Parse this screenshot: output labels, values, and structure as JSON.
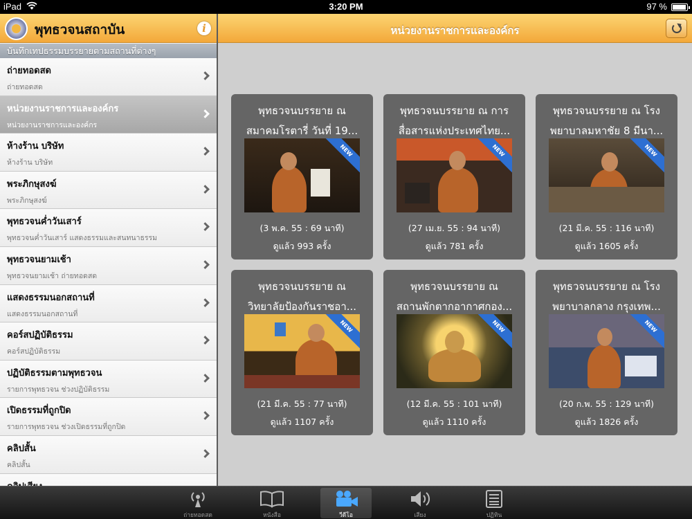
{
  "status": {
    "device": "iPad",
    "time": "3:20 PM",
    "battery": "97 %",
    "battery_level": 0.97
  },
  "sidebar": {
    "title": "พุทธวจนสถาบัน",
    "section": "บันทึกเทปธรรมบรรยายตามสถานที่ต่างๆ",
    "items": [
      {
        "label": "ถ่ายทอดสด",
        "sub": "ถ่ายทอดสด"
      },
      {
        "label": "หน่วยงานราชการและองค์กร",
        "sub": "หน่วยงานราชการและองค์กร"
      },
      {
        "label": "ห้างร้าน บริษัท",
        "sub": "ห้างร้าน บริษัท"
      },
      {
        "label": "พระภิกษุสงฆ์",
        "sub": "พระภิกษุสงฆ์"
      },
      {
        "label": "พุทธวจนค่ำวันเสาร์",
        "sub": "พุทธวจนค่ำวันเสาร์ แสดงธรรมและสนทนาธรรม"
      },
      {
        "label": "พุทธวจนยามเช้า",
        "sub": "พุทธวจนยามเช้า ถ่ายทอดสด"
      },
      {
        "label": "แสดงธรรมนอกสถานที่",
        "sub": "แสดงธรรมนอกสถานที่"
      },
      {
        "label": "คอร์สปฏิบัติธรรม",
        "sub": "คอร์สปฏิบัติธรรม"
      },
      {
        "label": "ปฏิบัติธรรมตามพุทธวจน",
        "sub": "รายการพุทธวจน ช่วงปฏิบัติธรรม"
      },
      {
        "label": "เปิดธรรมที่ถูกปิด",
        "sub": "รายการพุทธวจน ช่วงเปิดธรรมที่ถูกปิด"
      },
      {
        "label": "คลิปสั้น",
        "sub": "คลิปสั้น"
      },
      {
        "label": "คลิปเสียง",
        "sub": ""
      }
    ]
  },
  "main": {
    "title": "หน่วยงานราชการและองค์กร",
    "new_badge": "NEW",
    "cards": [
      {
        "line1": "พุทธวจนบรรยาย ณ",
        "line2": "สมาคมโรตารี่ วันที่ 19...",
        "meta": "(3 พ.ค. 55 : 69 นาที)",
        "views": "ดูแล้ว 993 ครั้ง"
      },
      {
        "line1": "พุทธวจนบรรยาย ณ การ",
        "line2": "สื่อสารแห่งประเทศไทย...",
        "meta": "(27 เม.ย. 55 : 94 นาที)",
        "views": "ดูแล้ว 781 ครั้ง"
      },
      {
        "line1": "พุทธวจนบรรยาย ณ โรง",
        "line2": "พยาบาลมหาชัย 8 มีนา...",
        "meta": "(21 มี.ค. 55 : 116 นาที)",
        "views": "ดูแล้ว 1605 ครั้ง"
      },
      {
        "line1": "พุทธวจนบรรยาย ณ",
        "line2": "วิทยาลัยป้องกันราชอา...",
        "meta": "(21 มี.ค. 55 : 77 นาที)",
        "views": "ดูแล้ว 1107 ครั้ง"
      },
      {
        "line1": "พุทธวจนบรรยาย ณ",
        "line2": "สถานพักตากอากาศกอง...",
        "meta": "(12 มี.ค. 55 : 101 นาที)",
        "views": "ดูแล้ว 1110 ครั้ง"
      },
      {
        "line1": "พุทธวจนบรรยาย ณ  โรง",
        "line2": "พยาบาลกลาง กรุงเทพ...",
        "meta": "(20 ก.พ. 55 : 129 นาที)",
        "views": "ดูแล้ว 1826 ครั้ง"
      }
    ]
  },
  "tabs": [
    {
      "label": "ถ่ายทอดสด",
      "icon": "broadcast-icon"
    },
    {
      "label": "หนังสือ",
      "icon": "book-icon"
    },
    {
      "label": "วีดีโอ",
      "icon": "video-camera-icon"
    },
    {
      "label": "เสียง",
      "icon": "speaker-icon"
    },
    {
      "label": "ปฏิทิน",
      "icon": "calendar-icon"
    }
  ]
}
